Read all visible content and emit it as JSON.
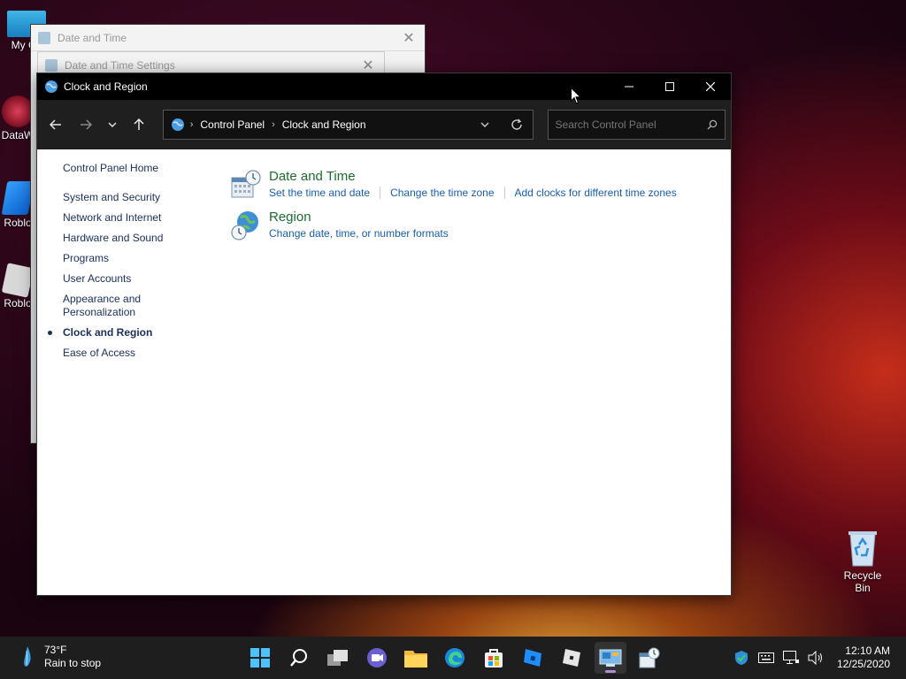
{
  "desktop": {
    "icons": [
      {
        "label": "My Co"
      },
      {
        "label": "DataW"
      },
      {
        "label": "Roblo"
      },
      {
        "label": "Roblo"
      },
      {
        "label": "Recycle Bin"
      }
    ]
  },
  "bg_windows": [
    {
      "title": "Date and Time"
    },
    {
      "title": "Date and Time Settings"
    }
  ],
  "window": {
    "title": "Clock and Region",
    "breadcrumb": [
      "Control Panel",
      "Clock and Region"
    ],
    "search_placeholder": "Search Control Panel",
    "sidebar": {
      "home": "Control Panel Home",
      "items": [
        "System and Security",
        "Network and Internet",
        "Hardware and Sound",
        "Programs",
        "User Accounts",
        "Appearance and Personalization",
        "Clock and Region",
        "Ease of Access"
      ],
      "active_index": 6
    },
    "categories": [
      {
        "title": "Date and Time",
        "links": [
          "Set the time and date",
          "Change the time zone",
          "Add clocks for different time zones"
        ]
      },
      {
        "title": "Region",
        "links": [
          "Change date, time, or number formats"
        ]
      }
    ]
  },
  "taskbar": {
    "weather_temp": "73°F",
    "weather_desc": "Rain to stop",
    "apps": [
      "start-icon",
      "search-icon",
      "task-view-icon",
      "chat-icon",
      "file-explorer-icon",
      "edge-icon",
      "store-icon",
      "roblox-studio-icon",
      "roblox-icon",
      "control-panel-icon",
      "date-time-icon"
    ],
    "time": "12:10 AM",
    "date": "12/25/2020"
  },
  "colors": {
    "link": "#1a5ea8",
    "category_title": "#1e6b2f",
    "nav_text": "#1a2f5a"
  }
}
